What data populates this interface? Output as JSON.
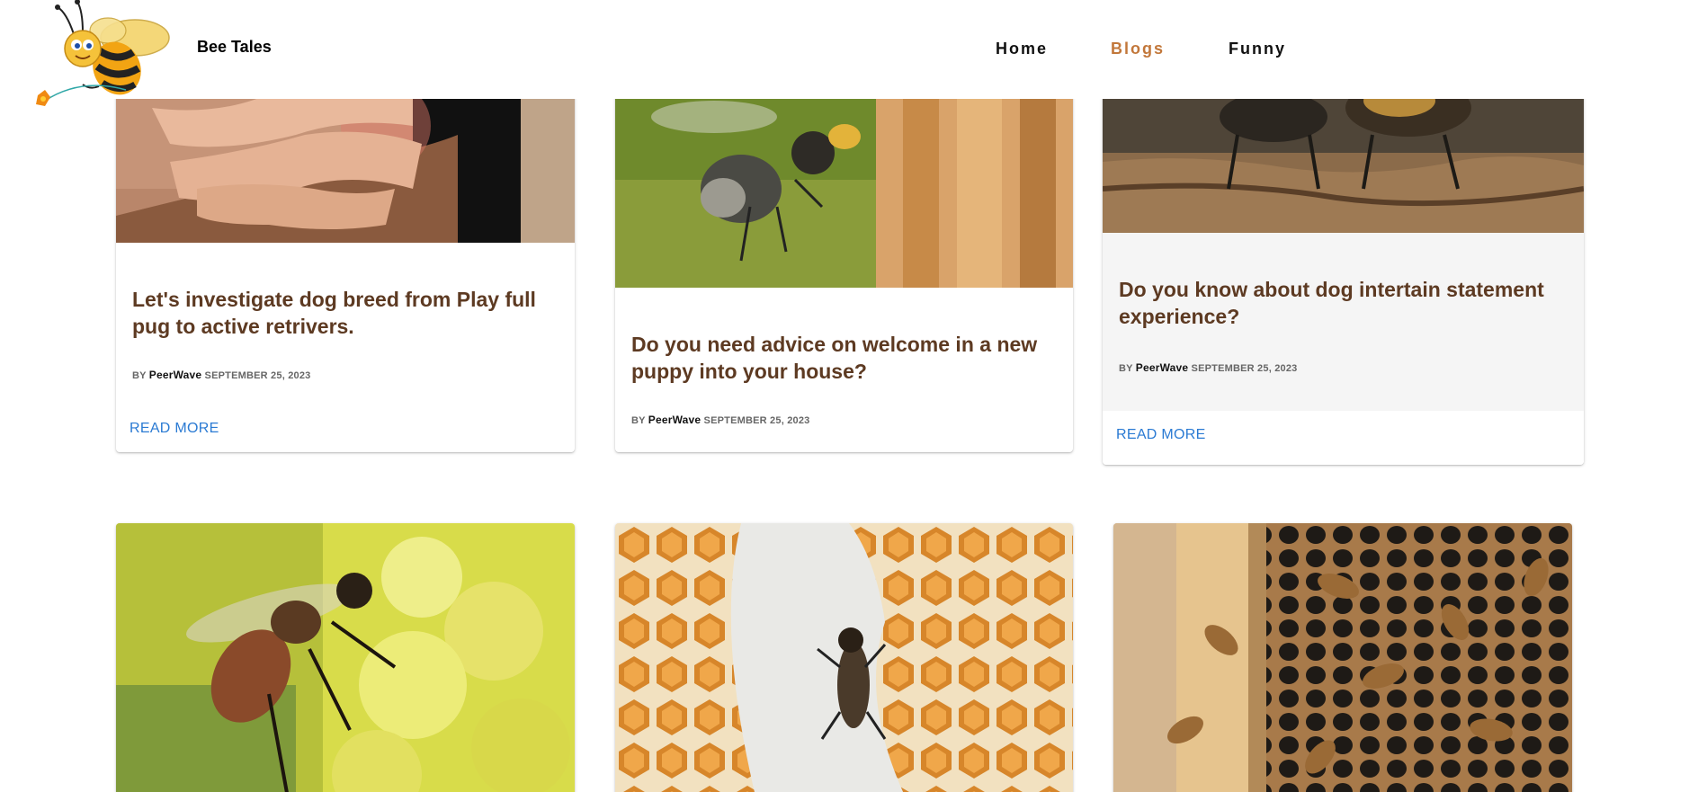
{
  "header": {
    "brand": "Bee Tales",
    "nav": {
      "home": "Home",
      "blogs": "Blogs",
      "funny": "Funny"
    },
    "active_nav": "Blogs",
    "active_color": "#c2773a"
  },
  "colors": {
    "title": "#5d3a22",
    "link": "#2a7ad3",
    "card_alt_bg": "#f5f5f5"
  },
  "posts": [
    {
      "title": "Let's investigate dog breed from Play full pug to active retrivers.",
      "by": "BY",
      "author": "PeerWave",
      "date": "SEPTEMBER 25, 2023",
      "read_more": "READ MORE",
      "image": "hand-with-bee-sting"
    },
    {
      "title": "Do you need advice on welcome in a new puppy into your house?",
      "by": "BY",
      "author": "PeerWave",
      "date": "SEPTEMBER 25, 2023",
      "image": "bee-flying-to-hive"
    },
    {
      "title": "Do you know about dog intertain statement experience?",
      "by": "BY",
      "author": "PeerWave",
      "date": "SEPTEMBER 25, 2023",
      "read_more": "READ MORE",
      "image": "bees-on-wood"
    },
    {
      "image": "bee-on-yellow-flowers"
    },
    {
      "image": "bee-on-honeycomb"
    },
    {
      "image": "bees-on-hive-frame"
    }
  ]
}
